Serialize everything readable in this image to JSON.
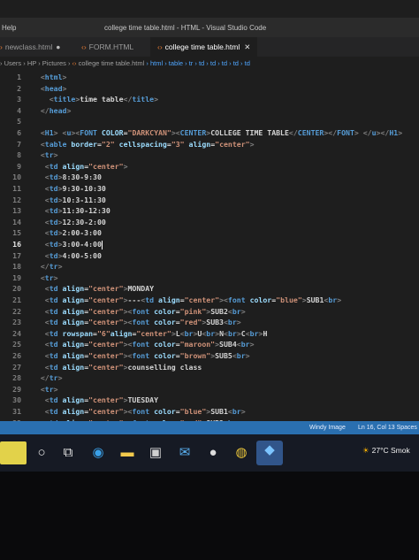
{
  "window": {
    "menu": "Help",
    "title": "college time table.html - HTML - Visual Studio Code"
  },
  "tabs": [
    {
      "label": "newclass.html",
      "modified": "●"
    },
    {
      "label": "FORM.HTML"
    },
    {
      "label": "college time table.html",
      "close": "✕"
    }
  ],
  "breadcrumb": {
    "path": "› Users › HP › Pictures ›",
    "file": "college time table.html",
    "trail": "› html › table › tr › td › td › td › td › td"
  },
  "editor": {
    "current_line": 16,
    "lines": [
      {
        "n": "1",
        "html": "  <span class='p'>&lt;</span><span class='t'>html</span><span class='p'>&gt;</span>"
      },
      {
        "n": "2",
        "html": "  <span class='p'>&lt;</span><span class='t'>head</span><span class='p'>&gt;</span>"
      },
      {
        "n": "3",
        "html": "    <span class='p'>&lt;</span><span class='t'>title</span><span class='p'>&gt;</span>time table<span class='p'>&lt;/</span><span class='t'>title</span><span class='p'>&gt;</span>"
      },
      {
        "n": "4",
        "html": "  <span class='p'>&lt;/</span><span class='t'>head</span><span class='p'>&gt;</span>"
      },
      {
        "n": "5",
        "html": ""
      },
      {
        "n": "6",
        "html": "  <span class='p'>&lt;</span><span class='t'>H1</span><span class='p'>&gt;</span> <span class='p'>&lt;</span><span class='t'>u</span><span class='p'>&gt;&lt;</span><span class='t'>FONT</span> <span class='a'>COLOR</span>=<span class='s'>\"DARKCYAN\"</span><span class='p'>&gt;&lt;</span><span class='t'>CENTER</span><span class='p'>&gt;</span>COLLEGE TIME TABLE<span class='p'>&lt;/</span><span class='t'>CENTER</span><span class='p'>&gt;&lt;/</span><span class='t'>FONT</span><span class='p'>&gt;</span> <span class='p'>&lt;/</span><span class='t'>u</span><span class='p'>&gt;&lt;/</span><span class='t'>H1</span><span class='p'>&gt;</span>"
      },
      {
        "n": "7",
        "html": "  <span class='p'>&lt;</span><span class='t'>table</span> <span class='a'>border</span>=<span class='s'>\"2\"</span> <span class='a'>cellspacing</span>=<span class='s'>\"3\"</span> <span class='a'>align</span>=<span class='s'>\"center\"</span><span class='p'>&gt;</span>"
      },
      {
        "n": "8",
        "html": "  <span class='p'>&lt;</span><span class='t'>tr</span><span class='p'>&gt;</span>"
      },
      {
        "n": "9",
        "html": "   <span class='p'>&lt;</span><span class='t'>td</span> <span class='a'>align</span>=<span class='s'>\"center\"</span><span class='p'>&gt;</span>"
      },
      {
        "n": "10",
        "html": "   <span class='p'>&lt;</span><span class='t'>td</span><span class='p'>&gt;</span>8:30-9:30"
      },
      {
        "n": "11",
        "html": "   <span class='p'>&lt;</span><span class='t'>td</span><span class='p'>&gt;</span>9:30-10:30"
      },
      {
        "n": "12",
        "html": "   <span class='p'>&lt;</span><span class='t'>td</span><span class='p'>&gt;</span>10:3-11:30"
      },
      {
        "n": "13",
        "html": "   <span class='p'>&lt;</span><span class='t'>td</span><span class='p'>&gt;</span>11:30-12:30"
      },
      {
        "n": "14",
        "html": "   <span class='p'>&lt;</span><span class='t'>td</span><span class='p'>&gt;</span>12:30-2:00"
      },
      {
        "n": "15",
        "html": "   <span class='p'>&lt;</span><span class='t'>td</span><span class='p'>&gt;</span>2:00-3:00"
      },
      {
        "n": "16",
        "html": "   <span class='p'>&lt;</span><span class='t'>td</span><span class='p'>&gt;</span>3:00-4:00<span class='cursor'></span>"
      },
      {
        "n": "17",
        "html": "   <span class='p'>&lt;</span><span class='t'>td</span><span class='p'>&gt;</span>4:00-5:00"
      },
      {
        "n": "18",
        "html": "  <span class='p'>&lt;/</span><span class='t'>tr</span><span class='p'>&gt;</span>"
      },
      {
        "n": "19",
        "html": "  <span class='p'>&lt;</span><span class='t'>tr</span><span class='p'>&gt;</span>"
      },
      {
        "n": "20",
        "html": "   <span class='p'>&lt;</span><span class='t'>td</span> <span class='a'>align</span>=<span class='s'>\"center\"</span><span class='p'>&gt;</span>MONDAY"
      },
      {
        "n": "21",
        "html": "   <span class='p'>&lt;</span><span class='t'>td</span> <span class='a'>align</span>=<span class='s'>\"center\"</span><span class='p'>&gt;</span>---<span class='p'>&lt;</span><span class='t'>td</span> <span class='a'>align</span>=<span class='s'>\"center\"</span><span class='p'>&gt;&lt;</span><span class='t'>font</span> <span class='a'>color</span>=<span class='s'>\"blue\"</span><span class='p'>&gt;</span>SUB1<span class='p'>&lt;</span><span class='t'>br</span><span class='p'>&gt;</span>"
      },
      {
        "n": "22",
        "html": "   <span class='p'>&lt;</span><span class='t'>td</span> <span class='a'>align</span>=<span class='s'>\"center\"</span><span class='p'>&gt;&lt;</span><span class='t'>font</span> <span class='a'>color</span>=<span class='s'>\"pink\"</span><span class='p'>&gt;</span>SUB2<span class='p'>&lt;</span><span class='t'>br</span><span class='p'>&gt;</span>"
      },
      {
        "n": "23",
        "html": "   <span class='p'>&lt;</span><span class='t'>td</span> <span class='a'>align</span>=<span class='s'>\"center\"</span><span class='p'>&gt;&lt;</span><span class='t'>font</span> <span class='a'>color</span>=<span class='s'>\"red\"</span><span class='p'>&gt;</span>SUB3<span class='p'>&lt;</span><span class='t'>br</span><span class='p'>&gt;</span>"
      },
      {
        "n": "24",
        "html": "   <span class='p'>&lt;</span><span class='t'>td</span> <span class='a'>rowspan</span>=<span class='s'>\"6\"</span><span class='a'>align</span>=<span class='s'>\"center\"</span><span class='p'>&gt;</span>L<span class='p'>&lt;</span><span class='t'>br</span><span class='p'>&gt;</span>U<span class='p'>&lt;</span><span class='t'>br</span><span class='p'>&gt;</span>N<span class='p'>&lt;</span><span class='t'>br</span><span class='p'>&gt;</span>C<span class='p'>&lt;</span><span class='t'>br</span><span class='p'>&gt;</span>H"
      },
      {
        "n": "25",
        "html": "   <span class='p'>&lt;</span><span class='t'>td</span> <span class='a'>align</span>=<span class='s'>\"center\"</span><span class='p'>&gt;&lt;</span><span class='t'>font</span> <span class='a'>color</span>=<span class='s'>\"maroon\"</span><span class='p'>&gt;</span>SUB4<span class='p'>&lt;</span><span class='t'>br</span><span class='p'>&gt;</span>"
      },
      {
        "n": "26",
        "html": "   <span class='p'>&lt;</span><span class='t'>td</span> <span class='a'>align</span>=<span class='s'>\"center\"</span><span class='p'>&gt;&lt;</span><span class='t'>font</span> <span class='a'>color</span>=<span class='s'>\"brown\"</span><span class='p'>&gt;</span>SUB5<span class='p'>&lt;</span><span class='t'>br</span><span class='p'>&gt;</span>"
      },
      {
        "n": "27",
        "html": "   <span class='p'>&lt;</span><span class='t'>td</span> <span class='a'>align</span>=<span class='s'>\"center\"</span><span class='p'>&gt;</span>counselling class"
      },
      {
        "n": "28",
        "html": "  <span class='p'>&lt;/</span><span class='t'>tr</span><span class='p'>&gt;</span>"
      },
      {
        "n": "29",
        "html": "  <span class='p'>&lt;</span><span class='t'>tr</span><span class='p'>&gt;</span>"
      },
      {
        "n": "30",
        "html": "   <span class='p'>&lt;</span><span class='t'>td</span> <span class='a'>align</span>=<span class='s'>\"center\"</span><span class='p'>&gt;</span>TUESDAY"
      },
      {
        "n": "31",
        "html": "   <span class='p'>&lt;</span><span class='t'>td</span> <span class='a'>align</span>=<span class='s'>\"center\"</span><span class='p'>&gt;&lt;</span><span class='t'>font</span> <span class='a'>color</span>=<span class='s'>\"blue\"</span><span class='p'>&gt;</span>SUB1<span class='p'>&lt;</span><span class='t'>br</span><span class='p'>&gt;</span>"
      },
      {
        "n": "32",
        "html": "   <span class='p'>&lt;</span><span class='t'>td</span> <span class='a'>align</span>=<span class='s'>\"center\"</span><span class='p'>&gt;&lt;</span><span class='t'>font</span> <span class='a'>color</span>=<span class='s'>\"red\"</span><span class='p'>&gt;</span>SUB2<span class='p'>&lt;</span><span class='t'>br</span><span class='p'>&gt;</span>"
      }
    ]
  },
  "statusbar": {
    "left": "Windy Image",
    "right": "Ln 16, Col 13  Spaces"
  },
  "taskbar": {
    "icons": [
      "start-icon",
      "search-icon",
      "task-view-icon",
      "edge-icon",
      "file-explorer-icon",
      "store-icon",
      "mail-icon",
      "chat-icon",
      "chrome-icon",
      "vscode-icon"
    ],
    "weather": "27°C  Smok"
  },
  "colors": {
    "tag": "#569cd6",
    "attribute": "#9cdcfe",
    "string": "#ce9178",
    "status_bar": "#2a6fb0",
    "tab_icon": "#e37933"
  }
}
